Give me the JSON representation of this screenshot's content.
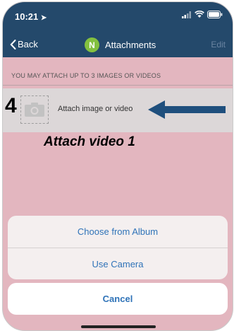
{
  "status_bar": {
    "time": "10:21"
  },
  "nav": {
    "back_label": "Back",
    "avatar_initial": "N",
    "title": "Attachments",
    "edit_label": "Edit"
  },
  "section": {
    "header": "YOU MAY ATTACH UP TO 3 IMAGES OR VIDEOS"
  },
  "attach_row": {
    "step_number": "4",
    "label": "Attach image or video"
  },
  "caption": "Attach video 1",
  "action_sheet": {
    "options": [
      "Choose from Album",
      "Use Camera"
    ],
    "cancel_label": "Cancel"
  },
  "colors": {
    "nav_bar": "#24496b",
    "overlay": "#e3b6bf",
    "avatar": "#83c03f",
    "action_text": "#2f73b8"
  }
}
